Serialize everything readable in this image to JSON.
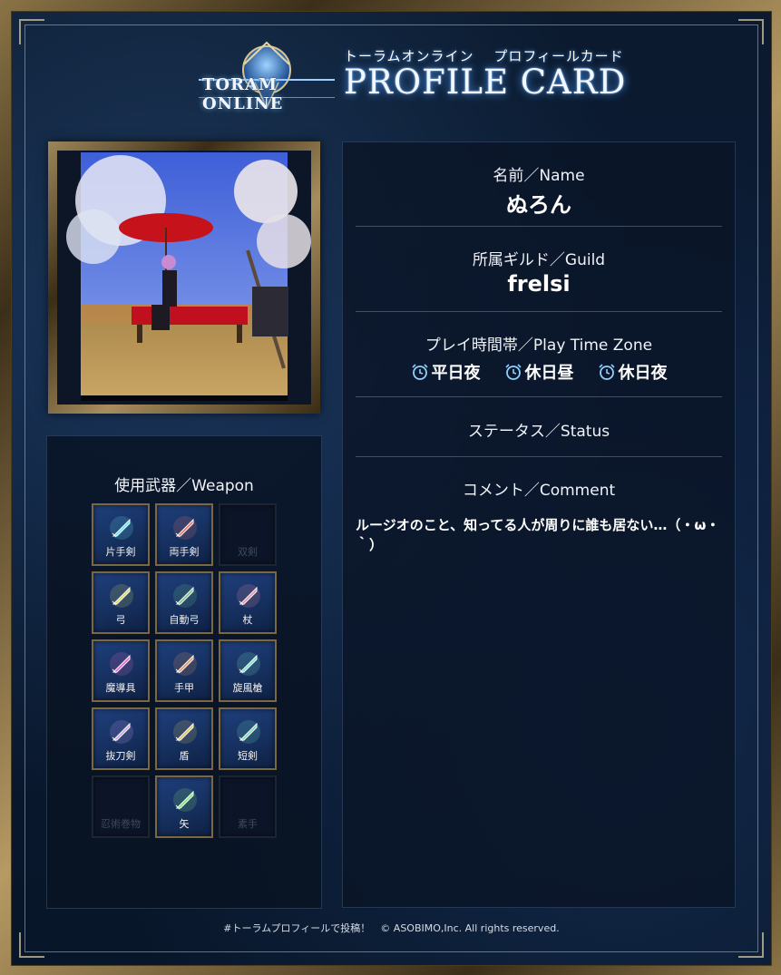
{
  "header": {
    "logo_text": "TORAM ONLINE",
    "subtitle": "トーラムオンライン　 プロフィールカード",
    "title": "PROFILE CARD"
  },
  "weapons": {
    "title": "使用武器／Weapon",
    "items": [
      {
        "label": "片手剣",
        "active": true,
        "icon": "one-handed-sword-icon"
      },
      {
        "label": "両手剣",
        "active": true,
        "icon": "two-handed-sword-icon"
      },
      {
        "label": "双剣",
        "active": false,
        "icon": "dual-swords-icon"
      },
      {
        "label": "弓",
        "active": true,
        "icon": "bow-icon"
      },
      {
        "label": "自動弓",
        "active": true,
        "icon": "bowgun-icon"
      },
      {
        "label": "杖",
        "active": true,
        "icon": "staff-icon"
      },
      {
        "label": "魔導具",
        "active": true,
        "icon": "magic-device-icon"
      },
      {
        "label": "手甲",
        "active": true,
        "icon": "knuckles-icon"
      },
      {
        "label": "旋風槍",
        "active": true,
        "icon": "halberd-icon"
      },
      {
        "label": "抜刀剣",
        "active": true,
        "icon": "katana-icon"
      },
      {
        "label": "盾",
        "active": true,
        "icon": "shield-icon"
      },
      {
        "label": "短剣",
        "active": true,
        "icon": "dagger-icon"
      },
      {
        "label": "忍術巻物",
        "active": false,
        "icon": "ninjutsu-scroll-icon"
      },
      {
        "label": "矢",
        "active": true,
        "icon": "arrow-icon"
      },
      {
        "label": "素手",
        "active": false,
        "icon": "bare-hand-icon"
      }
    ]
  },
  "profile": {
    "name_label": "名前／Name",
    "name": "ぬろん",
    "guild_label": "所属ギルド／Guild",
    "guild": "frelsi",
    "playtime_label": "プレイ時間帯／Play Time Zone",
    "playtimes": [
      "平日夜",
      "休日昼",
      "休日夜"
    ],
    "status_label": "ステータス／Status",
    "comment_label": "コメント／Comment",
    "comment": "ルージオのこと、知ってる人が周りに誰も居ない…（・ω・｀）"
  },
  "footer": {
    "text": "#トーラムプロフィールで投稿！　© ASOBIMO,Inc. All rights reserved."
  },
  "colors": {
    "background": "#0b1a2e",
    "gold_frame": "#9c865a",
    "weapon_cell": "#1f3f7c"
  }
}
